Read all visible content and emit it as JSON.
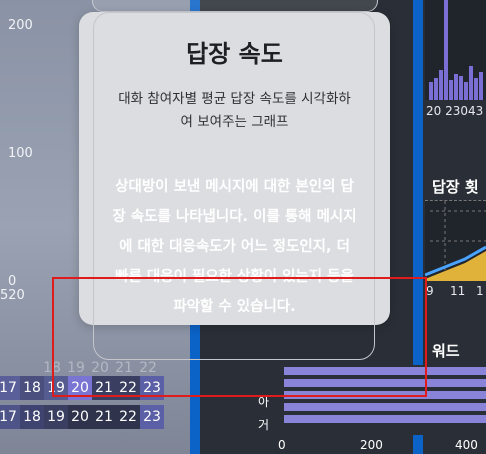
{
  "background": {
    "left_axis": [
      "200",
      "100",
      "0",
      "520"
    ],
    "heatmap_rows": [
      [
        "17",
        "18",
        "19",
        "20",
        "21",
        "22",
        "23"
      ],
      [
        "17",
        "18",
        "19",
        "20",
        "21",
        "22",
        "23"
      ]
    ],
    "heatmap_ghost_row": [
      "18",
      "19",
      "20",
      "21",
      "22"
    ],
    "right_top_label": "20 23043",
    "reply_count_title": "답장 횟",
    "right_mid_ticks": [
      "9",
      "11",
      "1"
    ],
    "keyword_title": "워드",
    "bottom_chart": {
      "y_labels": [
        "아",
        "거"
      ],
      "x_ticks": [
        "0",
        "200",
        "400"
      ]
    },
    "colors": {
      "blue": "#0b63c8",
      "purple": "#7b6fd6",
      "highlight": "#e01b1b"
    }
  },
  "card": {
    "title": "답장 속도",
    "description": "대화 참여자별 평균 답장 속도를 시각화하여 보여주는 그래프",
    "detail": "상대방이 보낸 메시지에 대한 본인의 답장 속도를 나타냅니다. 이를 통해 메시지에 대한 대응속도가 어느 정도인지, 더 빠른 대응이 필요한 상황이 있는지 등을 파악할 수 있습니다."
  }
}
